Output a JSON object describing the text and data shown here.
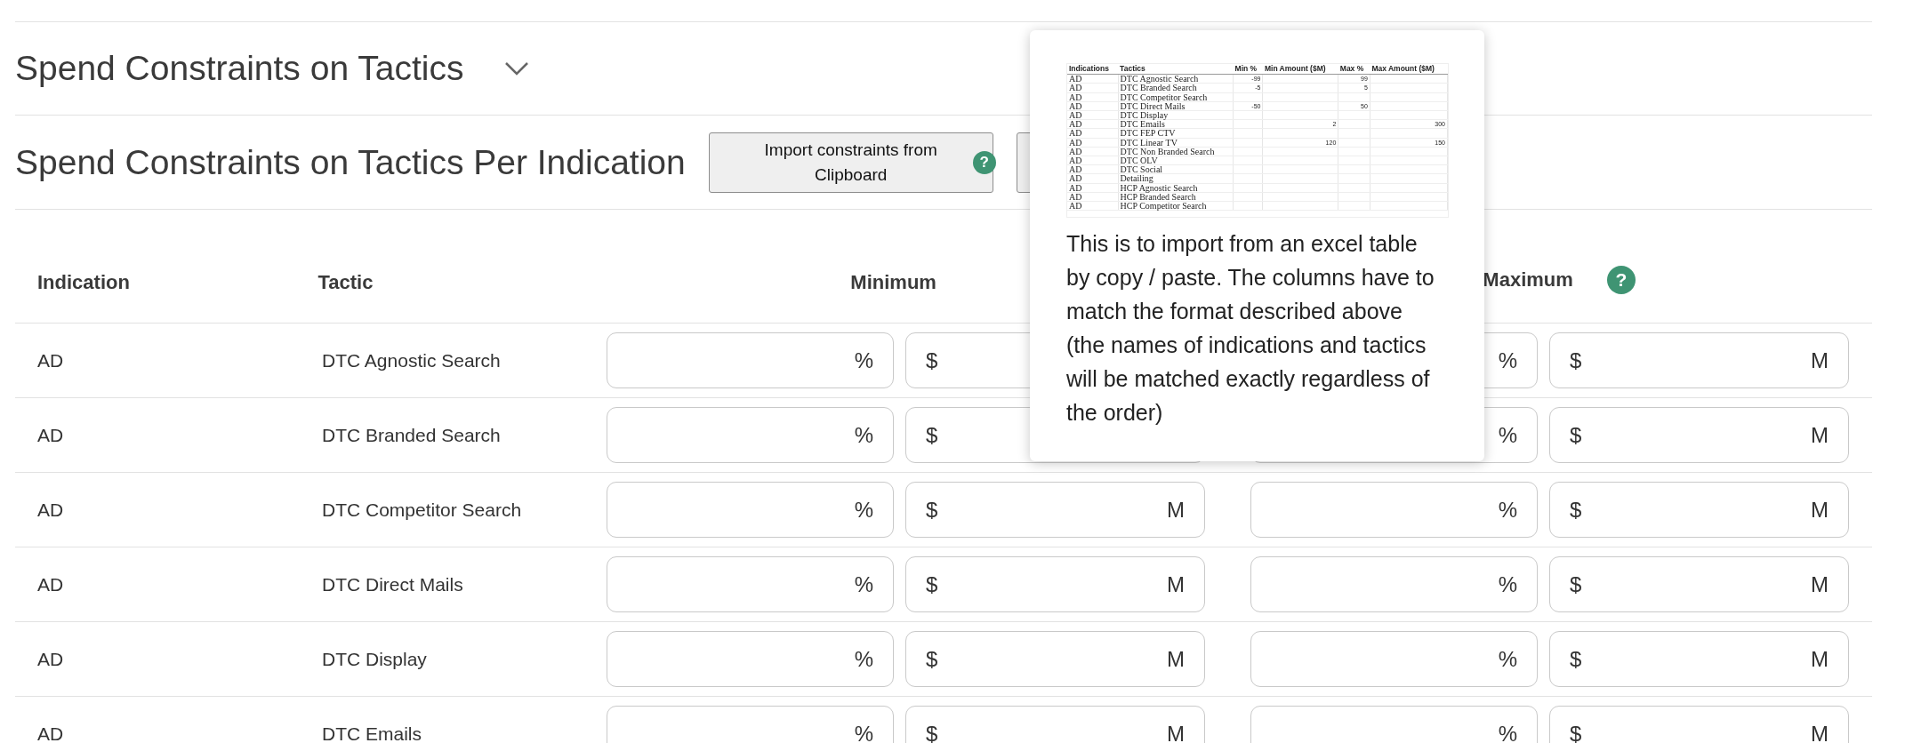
{
  "sections": [
    {
      "title": "Spend Constraints on Tactics",
      "expanded": false
    }
  ],
  "per_indication": {
    "title": "Spend Constraints on Tactics Per Indication",
    "buttons": [
      {
        "kind": "import",
        "label": "Import constraints from Clipboard",
        "help": "?"
      },
      {
        "kind": "blank"
      }
    ]
  },
  "table": {
    "columns": [
      {
        "label": "Indication"
      },
      {
        "label": "Tactic"
      },
      {
        "label": "Minimum"
      },
      {
        "label": "Maximum",
        "help": "?"
      }
    ],
    "rows": [
      {
        "indication": "AD",
        "tactic": "DTC Agnostic Search",
        "fields": [
          {
            "suffix": "%"
          },
          {
            "prefix": "$"
          },
          {
            "suffix": "%"
          },
          {
            "prefix": "$",
            "suffix": "M"
          }
        ]
      },
      {
        "indication": "AD",
        "tactic": "DTC Branded Search",
        "fields": [
          {
            "suffix": "%"
          },
          {
            "prefix": "$"
          },
          {
            "suffix": "%"
          },
          {
            "prefix": "$",
            "suffix": "M"
          }
        ]
      },
      {
        "indication": "AD",
        "tactic": "DTC Competitor Search",
        "fields": [
          {
            "suffix": "%"
          },
          {
            "prefix": "$",
            "suffix": "M"
          },
          {
            "suffix": "%"
          },
          {
            "prefix": "$",
            "suffix": "M"
          }
        ]
      },
      {
        "indication": "AD",
        "tactic": "DTC Direct Mails",
        "fields": [
          {
            "suffix": "%"
          },
          {
            "prefix": "$",
            "suffix": "M"
          },
          {
            "suffix": "%"
          },
          {
            "prefix": "$",
            "suffix": "M"
          }
        ]
      },
      {
        "indication": "AD",
        "tactic": "DTC Display",
        "fields": [
          {
            "suffix": "%"
          },
          {
            "prefix": "$",
            "suffix": "M"
          },
          {
            "suffix": "%"
          },
          {
            "prefix": "$",
            "suffix": "M"
          }
        ]
      },
      {
        "indication": "AD",
        "tactic": "DTC Emails",
        "fields": [
          {
            "suffix": "%"
          },
          {
            "prefix": "$",
            "suffix": "M"
          },
          {
            "suffix": "%"
          },
          {
            "prefix": "$",
            "suffix": "M"
          }
        ]
      }
    ]
  },
  "tooltip": {
    "text": "This is to import from an excel table by copy / paste. The columns have to match the format described above (the names of indications and tactics will be matched exactly regardless of the order)",
    "example_table": {
      "columns": [
        "Indications",
        "Tactics",
        "Min %",
        "Min Amount ($M)",
        "Max %",
        "Max Amount ($M)"
      ],
      "rows": [
        [
          "AD",
          "DTC Agnostic Search",
          "-99",
          null,
          "99",
          null
        ],
        [
          "AD",
          "DTC Branded Search",
          "-5",
          null,
          "5",
          null
        ],
        [
          "AD",
          "DTC Competitor Search",
          null,
          null,
          null,
          null
        ],
        [
          "AD",
          "DTC Direct Mails",
          "-50",
          null,
          "50",
          null
        ],
        [
          "AD",
          "DTC Display",
          null,
          null,
          null,
          null
        ],
        [
          "AD",
          "DTC Emails",
          null,
          "2",
          null,
          "300"
        ],
        [
          "AD",
          "DTC FEP CTV",
          null,
          null,
          null,
          null
        ],
        [
          "AD",
          "DTC Linear TV",
          null,
          "120",
          null,
          "150"
        ],
        [
          "AD",
          "DTC Non Branded Search",
          null,
          null,
          null,
          null
        ],
        [
          "AD",
          "DTC OLV",
          null,
          null,
          null,
          null
        ],
        [
          "AD",
          "DTC Social",
          null,
          null,
          null,
          null
        ],
        [
          "AD",
          "Detailing",
          null,
          null,
          null,
          null
        ],
        [
          "AD",
          "HCP Agnostic Search",
          null,
          null,
          null,
          null
        ],
        [
          "AD",
          "HCP Branded Search",
          null,
          null,
          null,
          null
        ],
        [
          "AD",
          "HCP Competitor Search",
          null,
          null,
          null,
          null
        ]
      ]
    }
  }
}
